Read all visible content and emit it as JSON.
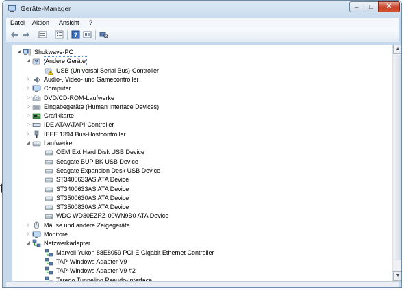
{
  "window": {
    "title": "Geräte-Manager",
    "controls": {
      "minimize": "–",
      "maximize": "□",
      "close": "✕"
    }
  },
  "menu": [
    "Datei",
    "Aktion",
    "Ansicht",
    "?"
  ],
  "toolbar": [
    "back-arrow-icon",
    "forward-arrow-icon",
    "properties-icon",
    "tree-view-icon",
    "help-icon",
    "resources-icon",
    "scan-hardware-icon"
  ],
  "tree": [
    {
      "label": "Shokwave-PC",
      "level": 0,
      "expander": "open",
      "icon": "computer-icon"
    },
    {
      "label": "Andere Geräte",
      "level": 1,
      "expander": "open",
      "icon": "unknown-device-icon",
      "selected": true
    },
    {
      "label": "USB (Universal Serial Bus)-Controller",
      "level": 2,
      "expander": "none",
      "icon": "warning-device-icon"
    },
    {
      "label": "Audio-, Video- und Gamecontroller",
      "level": 1,
      "expander": "closed",
      "icon": "speaker-icon"
    },
    {
      "label": "Computer",
      "level": 1,
      "expander": "closed",
      "icon": "monitor-icon"
    },
    {
      "label": "DVD/CD-ROM-Laufwerke",
      "level": 1,
      "expander": "closed",
      "icon": "disc-drive-icon"
    },
    {
      "label": "Eingabegeräte (Human Interface Devices)",
      "level": 1,
      "expander": "closed",
      "icon": "hid-icon"
    },
    {
      "label": "Grafikkarte",
      "level": 1,
      "expander": "closed",
      "icon": "display-adapter-icon"
    },
    {
      "label": "IDE ATA/ATAPI-Controller",
      "level": 1,
      "expander": "closed",
      "icon": "ide-controller-icon"
    },
    {
      "label": "IEEE 1394 Bus-Hostcontroller",
      "level": 1,
      "expander": "closed",
      "icon": "firewire-icon"
    },
    {
      "label": "Laufwerke",
      "level": 1,
      "expander": "open",
      "icon": "disk-drive-icon"
    },
    {
      "label": "OEM Ext Hard Disk USB Device",
      "level": 2,
      "expander": "none",
      "icon": "hard-disk-icon"
    },
    {
      "label": "Seagate BUP BK USB Device",
      "level": 2,
      "expander": "none",
      "icon": "hard-disk-icon"
    },
    {
      "label": "Seagate Expansion Desk USB Device",
      "level": 2,
      "expander": "none",
      "icon": "hard-disk-icon"
    },
    {
      "label": "ST3400633AS ATA Device",
      "level": 2,
      "expander": "none",
      "icon": "hard-disk-icon"
    },
    {
      "label": "ST3400633AS ATA Device",
      "level": 2,
      "expander": "none",
      "icon": "hard-disk-icon"
    },
    {
      "label": "ST3500630AS ATA Device",
      "level": 2,
      "expander": "none",
      "icon": "hard-disk-icon"
    },
    {
      "label": "ST3500830AS ATA Device",
      "level": 2,
      "expander": "none",
      "icon": "hard-disk-icon"
    },
    {
      "label": "WDC WD30EZRZ-00WN9B0 ATA Device",
      "level": 2,
      "expander": "none",
      "icon": "hard-disk-icon"
    },
    {
      "label": "Mäuse und andere Zeigegeräte",
      "level": 1,
      "expander": "closed",
      "icon": "mouse-icon"
    },
    {
      "label": "Monitore",
      "level": 1,
      "expander": "closed",
      "icon": "monitor-icon"
    },
    {
      "label": "Netzwerkadapter",
      "level": 1,
      "expander": "open",
      "icon": "network-adapter-icon"
    },
    {
      "label": "Marvell Yukon 88E8059 PCI-E Gigabit Ethernet Controller",
      "level": 2,
      "expander": "none",
      "icon": "network-adapter-icon"
    },
    {
      "label": "TAP-Windows Adapter V9",
      "level": 2,
      "expander": "none",
      "icon": "network-adapter-icon"
    },
    {
      "label": "TAP-Windows Adapter V9 #2",
      "level": 2,
      "expander": "none",
      "icon": "network-adapter-icon"
    },
    {
      "label": "Teredo Tunneling Pseudo-Interface",
      "level": 2,
      "expander": "none",
      "icon": "network-adapter-icon"
    }
  ],
  "background": {
    "side_letter": "t"
  }
}
